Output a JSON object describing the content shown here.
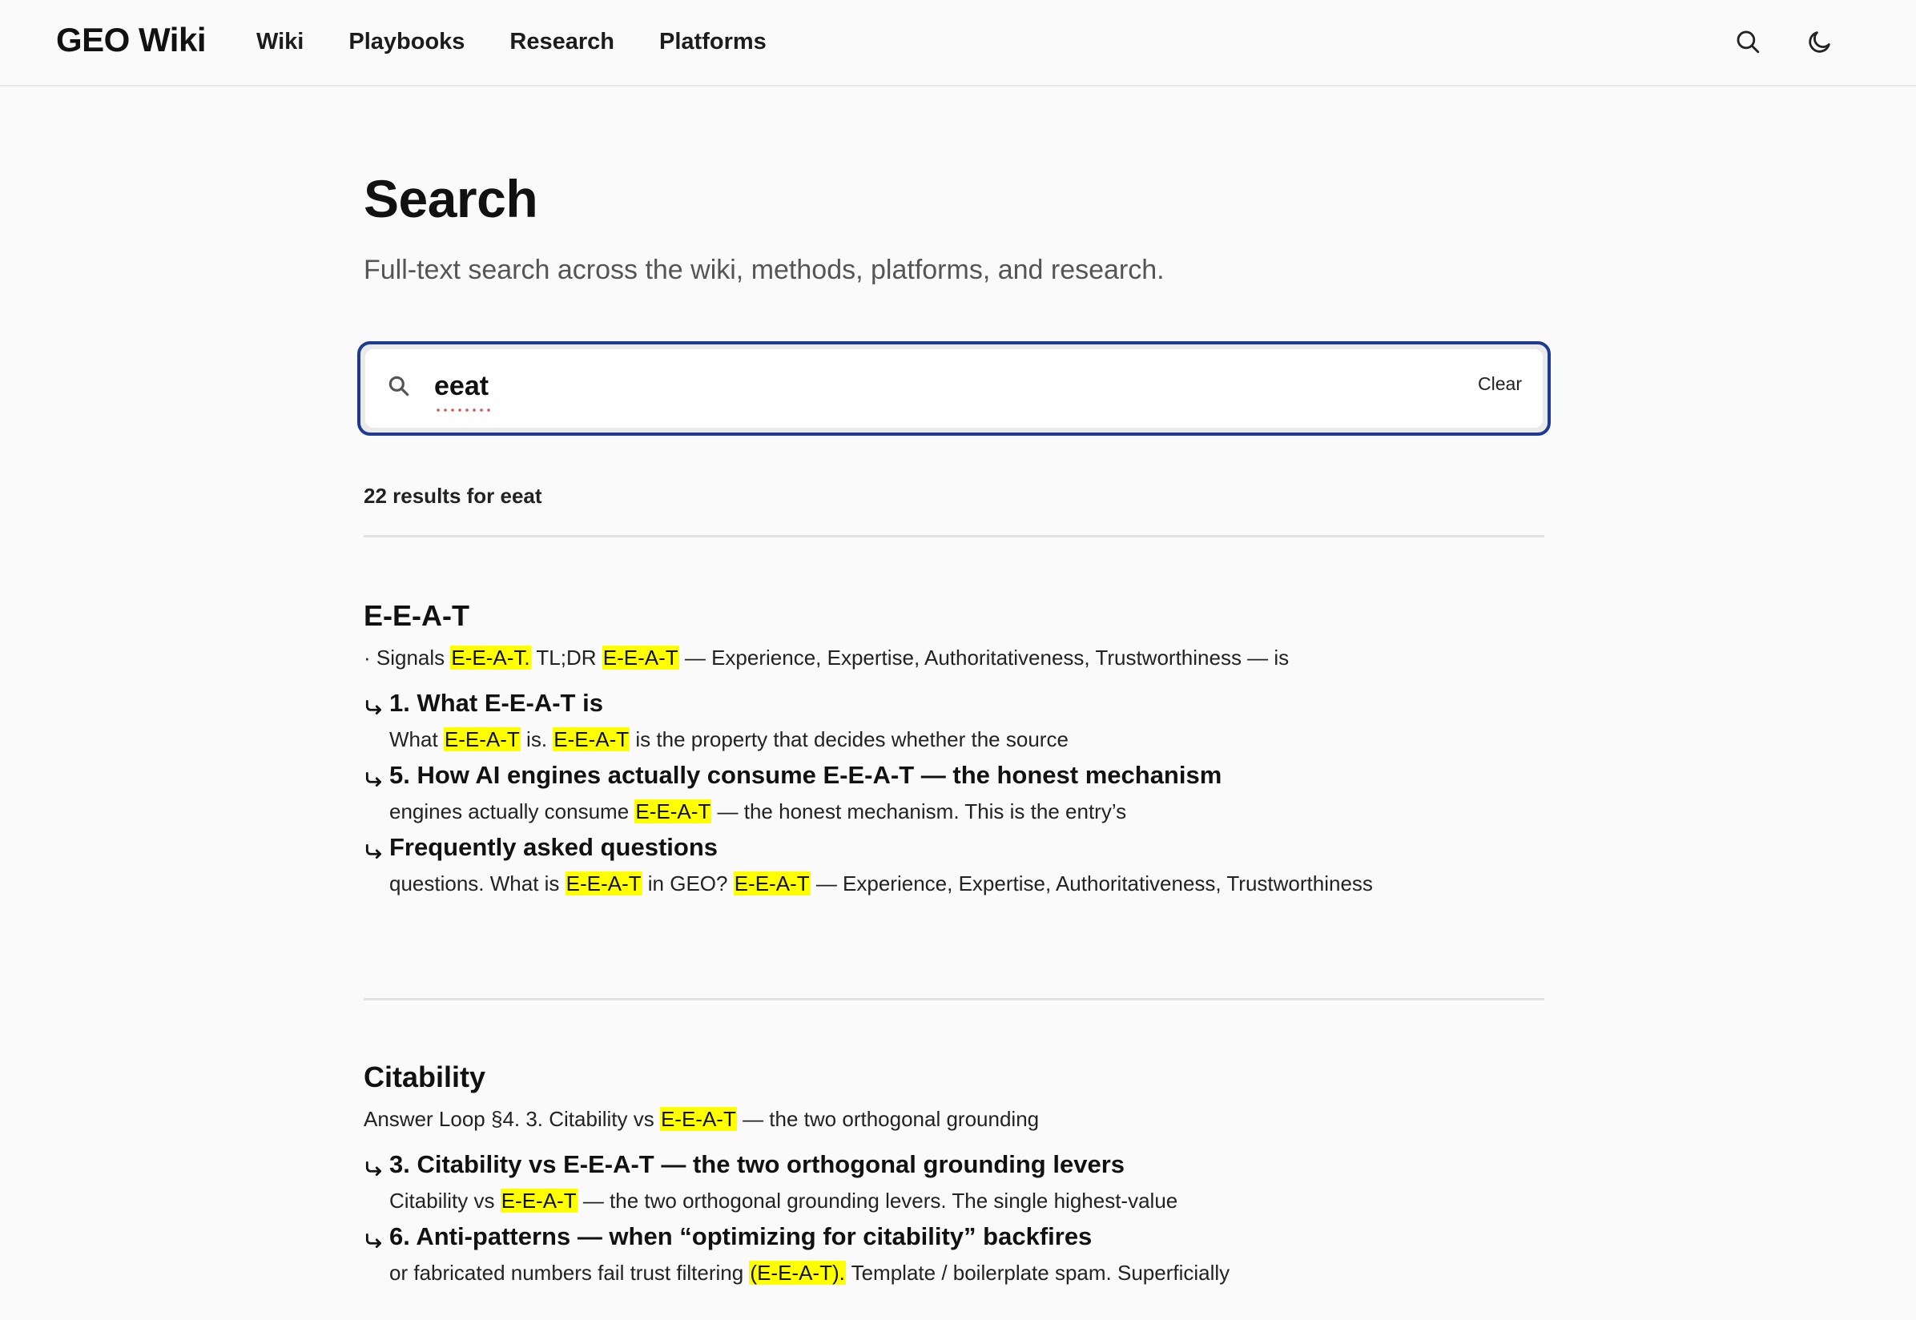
{
  "header": {
    "brand": "GEO Wiki",
    "nav": [
      "Wiki",
      "Playbooks",
      "Research",
      "Platforms"
    ]
  },
  "page": {
    "title": "Search",
    "subtitle": "Full-text search across the wiki, methods, platforms, and research."
  },
  "search": {
    "value": "eeat",
    "clear_label": "Clear"
  },
  "results_summary": "22 results for eeat",
  "results": [
    {
      "title": "E-E-A-T",
      "snippet": [
        "· Signals ",
        {
          "m": "E-E-A-T."
        },
        " TL;DR ",
        {
          "m": "E-E-A-T"
        },
        " — Experience, Expertise, Authoritativeness, Trustworthiness — is"
      ],
      "sections": [
        {
          "heading": "1. What E-E-A-T is",
          "snippet": [
            "What ",
            {
              "m": "E-E-A-T"
            },
            " is. ",
            {
              "m": "E-E-A-T"
            },
            " is the property that decides whether the source"
          ]
        },
        {
          "heading": "5. How AI engines actually consume E-E-A-T — the honest mechanism",
          "snippet": [
            "engines actually consume ",
            {
              "m": "E-E-A-T"
            },
            " — the honest mechanism. This is the entry’s"
          ]
        },
        {
          "heading": "Frequently asked questions",
          "snippet": [
            "questions. What is ",
            {
              "m": "E-E-A-T"
            },
            " in GEO? ",
            {
              "m": "E-E-A-T"
            },
            " — Experience, Expertise, Authoritativeness, Trustworthiness"
          ]
        }
      ]
    },
    {
      "title": "Citability",
      "snippet": [
        "Answer Loop §4. 3. Citability vs ",
        {
          "m": "E-E-A-T"
        },
        " — the two orthogonal grounding"
      ],
      "sections": [
        {
          "heading": "3. Citability vs E-E-A-T — the two orthogonal grounding levers",
          "snippet": [
            "Citability vs ",
            {
              "m": "E-E-A-T"
            },
            " — the two orthogonal grounding levers. The single highest-value"
          ]
        },
        {
          "heading": "6. Anti-patterns — when “optimizing for citability” backfires",
          "snippet": [
            "or fabricated numbers fail trust filtering ",
            {
              "m": "(E-E-A-T)."
            },
            " Template / boilerplate spam. Superficially"
          ]
        }
      ]
    }
  ]
}
